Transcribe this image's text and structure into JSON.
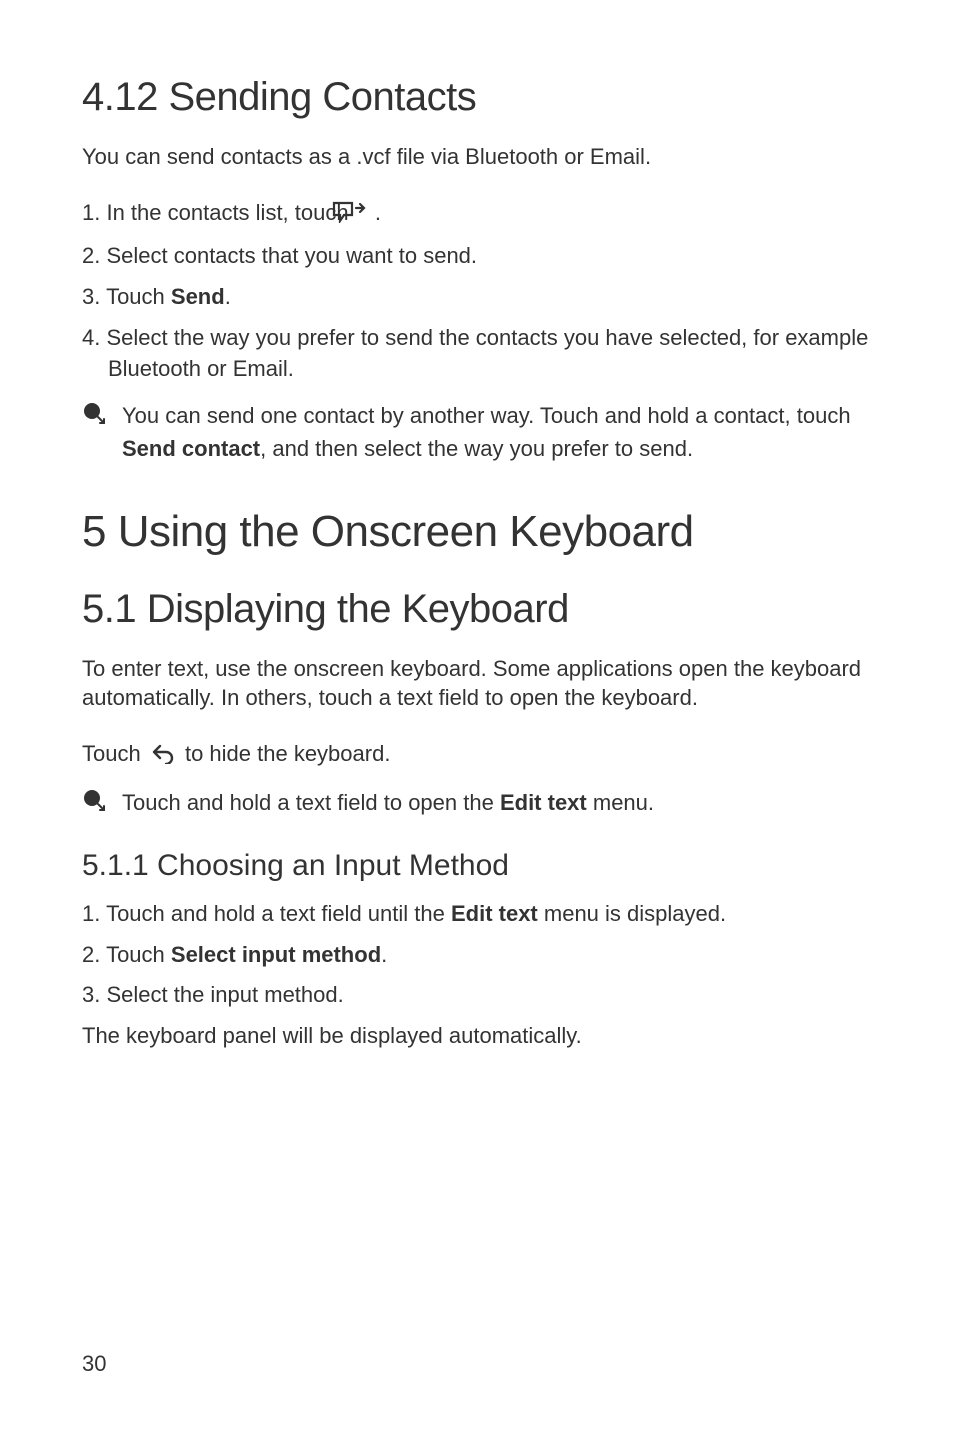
{
  "section412": {
    "heading": "4.12  Sending Contacts",
    "intro": "You can send contacts as a .vcf file via Bluetooth or Email.",
    "steps": [
      {
        "prefix": "1. ",
        "before": "In the contacts list, touch ",
        "after": " ."
      },
      {
        "prefix": "2. ",
        "text": "Select contacts that you want to send."
      },
      {
        "prefix": "3. ",
        "before": "Touch ",
        "bold": "Send",
        "after": "."
      },
      {
        "prefix": "4. ",
        "text": "Select the way you prefer to send the contacts you have selected, for example Bluetooth or Email."
      }
    ],
    "note": {
      "part1": "You can send one contact by another way. Touch and hold a contact, touch ",
      "bold": "Send contact",
      "part2": ", and then select the way you prefer to send."
    }
  },
  "section5": {
    "heading": "5  Using the Onscreen Keyboard"
  },
  "section51": {
    "heading": "5.1  Displaying the Keyboard",
    "intro": "To enter text, use the onscreen keyboard. Some applications open the keyboard automatically. In others, touch a text field to open the keyboard.",
    "touch_before": "Touch ",
    "touch_after": " to hide the keyboard.",
    "note": {
      "part1": "Touch and hold a text field to open the ",
      "bold": "Edit text",
      "part2": " menu."
    }
  },
  "section511": {
    "heading": "5.1.1  Choosing an Input Method",
    "steps": [
      {
        "prefix": "1. ",
        "before": "Touch and hold a text field until the ",
        "bold": "Edit text",
        "after": " menu is displayed."
      },
      {
        "prefix": "2. ",
        "before": "Touch ",
        "bold": "Select input method",
        "after": "."
      },
      {
        "prefix": "3. ",
        "text": "Select the input method."
      }
    ],
    "closing": "The keyboard panel will be displayed automatically."
  },
  "page_number": "30"
}
